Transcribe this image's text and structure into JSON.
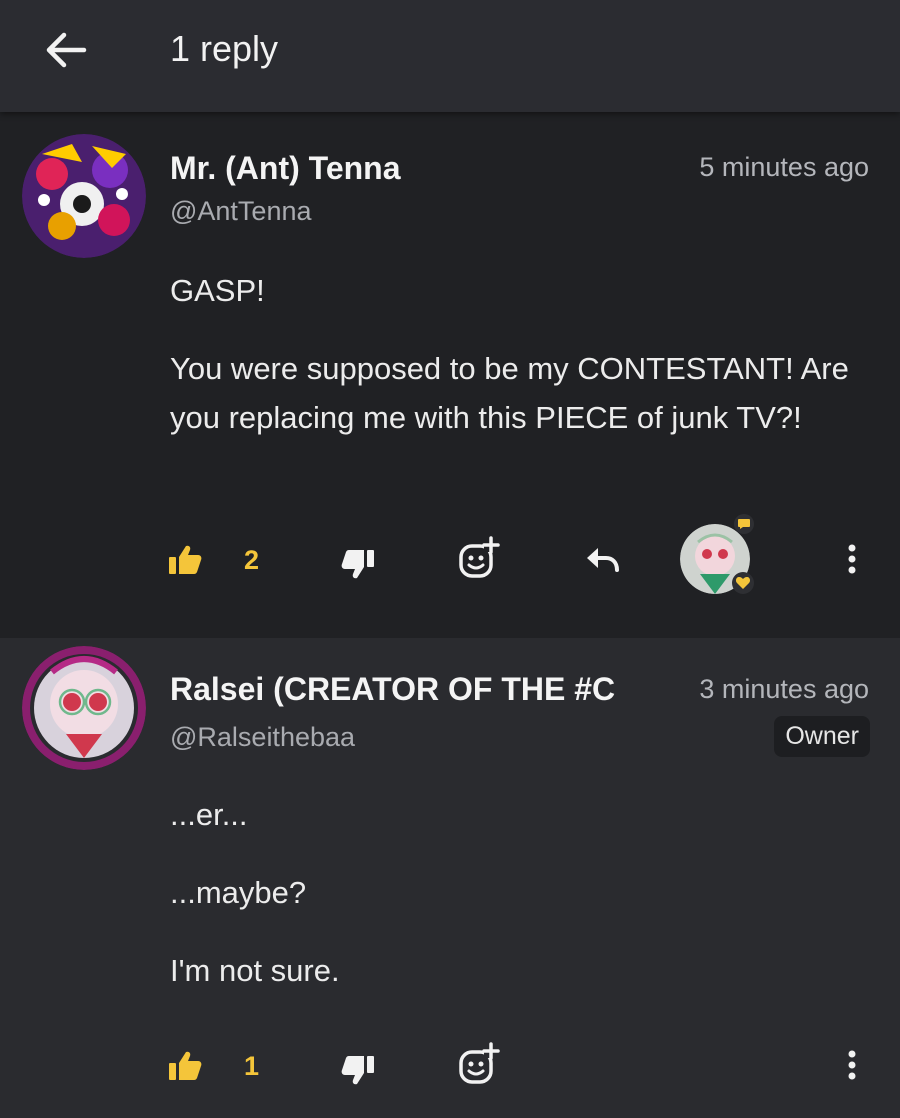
{
  "header": {
    "title": "1 reply",
    "back_icon": "arrow-left-icon"
  },
  "colors": {
    "accent": "#f4c53a",
    "parent_bg": "#202124",
    "reply_bg": "#2a2b2f",
    "header_bg": "#2b2c31"
  },
  "parent_comment": {
    "author_name": "Mr. (Ant) Tenna",
    "handle": "@AntTenna",
    "timestamp": "5 minutes ago",
    "paragraphs": [
      "GASP!",
      "You were supposed to be my CONTESTANT! Are you replacing me with this PIECE of junk TV?!"
    ],
    "likes": "2",
    "icons": [
      "thumbs-up-icon",
      "thumbs-down-icon",
      "add-reaction-icon",
      "reply-icon",
      "more-vertical-icon"
    ],
    "creator_heart": true
  },
  "reply_comment": {
    "author_name": "Ralsei (CREATOR OF THE #C",
    "handle": "@Ralseithebaa",
    "timestamp": "3 minutes ago",
    "badge": "Owner",
    "paragraphs": [
      "...er...",
      "...maybe?",
      "I'm not sure."
    ],
    "likes": "1",
    "icons": [
      "thumbs-up-icon",
      "thumbs-down-icon",
      "add-reaction-icon",
      "more-vertical-icon"
    ]
  }
}
